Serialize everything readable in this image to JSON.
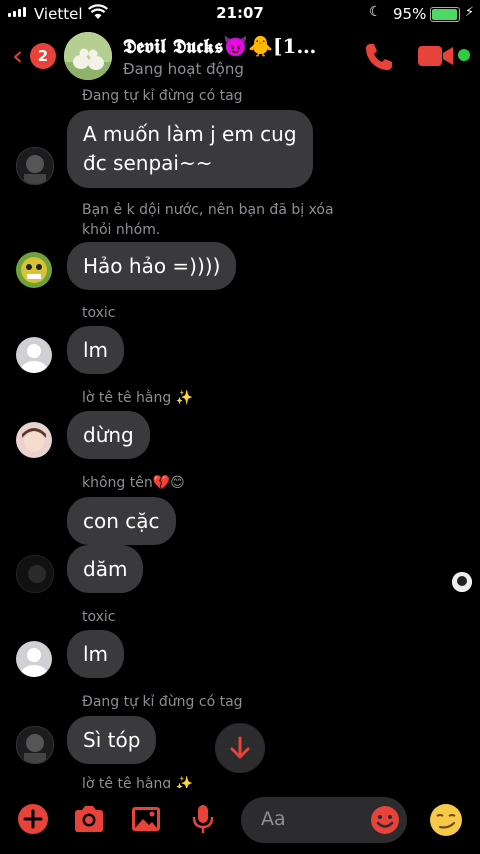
{
  "status_bar": {
    "carrier": "Viettel",
    "time": "21:07",
    "battery_pct": "95%",
    "battery_level": 0.95
  },
  "header": {
    "unread_count": "2",
    "title": "𝕯𝖊𝖛𝖎𝖑 𝕯𝖚𝖈𝖐𝖘😈🐥[1…",
    "subtitle": "Đang hoạt động",
    "accent": "#e8433a"
  },
  "messages": [
    {
      "sender": "Đang tự kỉ đừng có tag",
      "text": "A muốn làm j em cug\nđc senpai~~"
    },
    {
      "system": "Bạn ẻ k dội nước, nên bạn đã bị xóa khỏi nhóm.",
      "text": "Hảo hảo =))))"
    },
    {
      "sender": "toxic",
      "text": "lm"
    },
    {
      "sender": "lờ tê tê hằng ✨",
      "text": "dừng"
    },
    {
      "sender": "không tên💔😊",
      "text": "con cặc",
      "text2": "dăm"
    },
    {
      "sender": "toxic",
      "text": "lm"
    },
    {
      "sender": "Đang tự kỉ đừng có tag",
      "text": "Sì tóp"
    },
    {
      "sender": "lờ tê tê hằng ✨"
    }
  ],
  "composer": {
    "placeholder": "Aa"
  }
}
